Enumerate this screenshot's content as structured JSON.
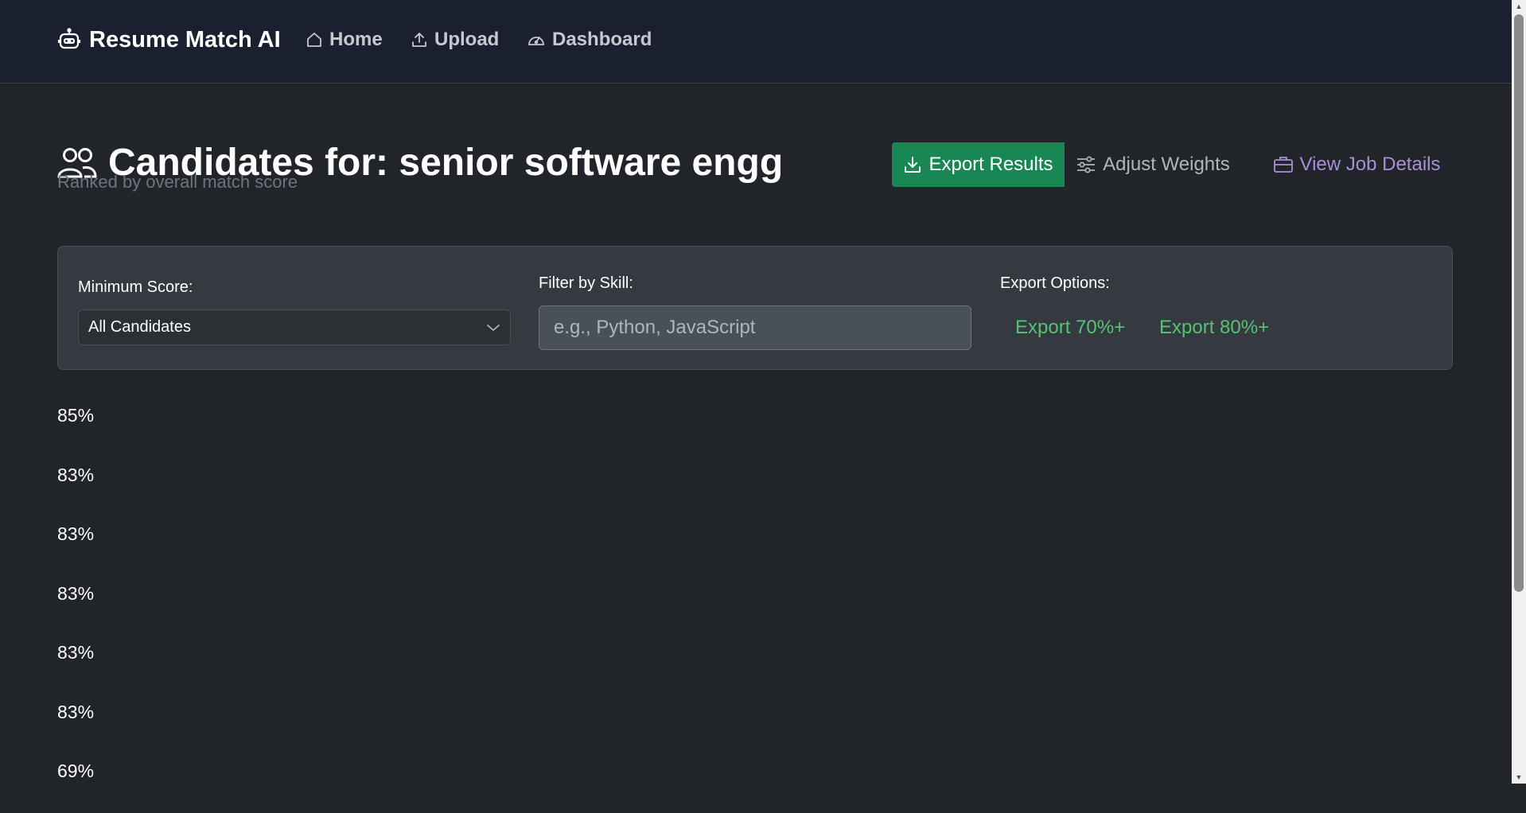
{
  "nav": {
    "brand": "Resume Match AI",
    "home": "Home",
    "upload": "Upload",
    "dashboard": "Dashboard"
  },
  "header": {
    "title": "Candidates for: senior software engg",
    "subtitle": "Ranked by overall match score",
    "export_results": "Export Results",
    "adjust_weights": "Adjust Weights",
    "view_job_details": "View Job Details"
  },
  "filters": {
    "min_score_label": "Minimum Score:",
    "min_score_value": "All Candidates",
    "skill_label": "Filter by Skill:",
    "skill_placeholder": "e.g., Python, JavaScript",
    "export_label": "Export Options:",
    "export_70": "Export 70%+",
    "export_80": "Export 80%+"
  },
  "scores": [
    "85%",
    "83%",
    "83%",
    "83%",
    "83%",
    "83%",
    "69%"
  ],
  "colors": {
    "background": "#212529",
    "navbar": "#1b2030",
    "success": "#198754",
    "export_link": "#56c274",
    "job_details_link": "#a98eda"
  }
}
